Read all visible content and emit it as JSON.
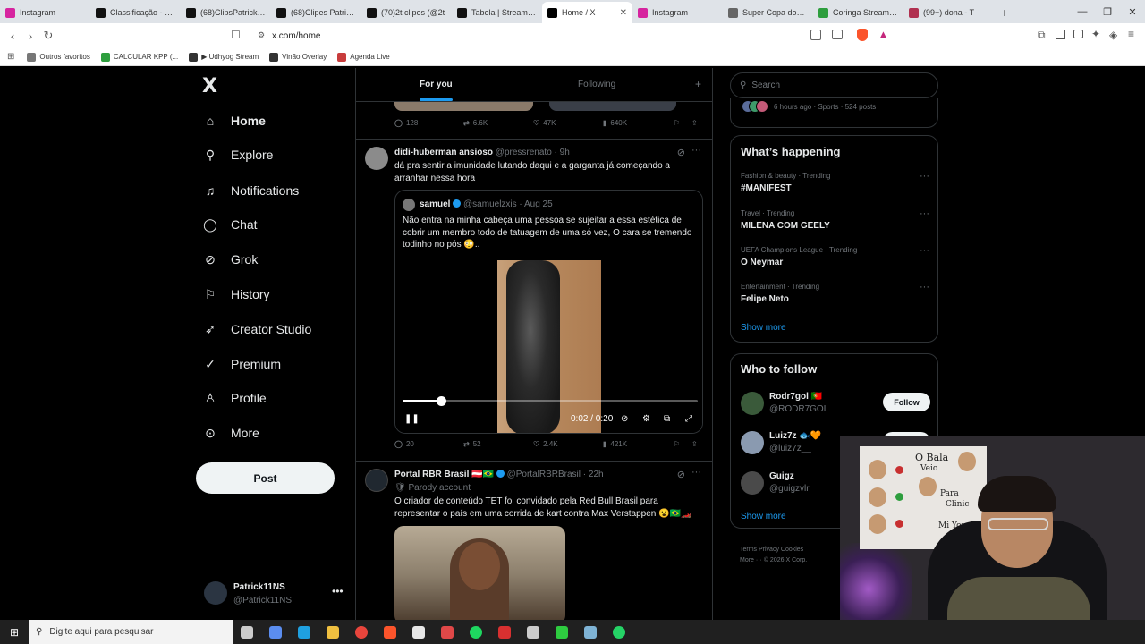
{
  "browser": {
    "tabs": [
      {
        "label": "Instagram",
        "color": "#d6249f",
        "active": false
      },
      {
        "label": "Classificação - Patri",
        "color": "#111111",
        "active": false
      },
      {
        "label": "(68)ClipsPatrickNs",
        "color": "#111111",
        "active": false
      },
      {
        "label": "(68)Clipes Patrick1",
        "color": "#111111",
        "active": false
      },
      {
        "label": "(70)2t clipes (@2t",
        "color": "#111111",
        "active": false
      },
      {
        "label": "Tabela | Streamme",
        "color": "#111111",
        "active": false
      },
      {
        "label": "Home / X",
        "color": "#000000",
        "active": true
      },
      {
        "label": "Instagram",
        "color": "#d6249f",
        "active": false
      },
      {
        "label": "Super Copa dos St",
        "color": "#666666",
        "active": false
      },
      {
        "label": "Coringa Stream - W",
        "color": "#2e9e3e",
        "active": false
      },
      {
        "label": "(99+) dona - T",
        "color": "#b03050",
        "active": false
      }
    ],
    "url": "x.com/home",
    "bookmarks": [
      {
        "label": "Outros favoritos",
        "color": "#777777"
      },
      {
        "label": "CALCULAR KPP (...",
        "color": "#2e9e3e"
      },
      {
        "label": "▶ Udhyog Stream",
        "color": "#333333"
      },
      {
        "label": "Vinão Overlay",
        "color": "#333333"
      },
      {
        "label": "Agenda Live",
        "color": "#c83c3c"
      }
    ]
  },
  "sidebar": {
    "logo": "X",
    "items": [
      {
        "label": "Home",
        "icon": "home-icon"
      },
      {
        "label": "Explore",
        "icon": "search-icon"
      },
      {
        "label": "Notifications",
        "icon": "bell-icon"
      },
      {
        "label": "Chat",
        "icon": "chat-icon"
      },
      {
        "label": "Grok",
        "icon": "grok-icon"
      },
      {
        "label": "History",
        "icon": "bookmark-icon"
      },
      {
        "label": "Creator Studio",
        "icon": "rocket-icon"
      },
      {
        "label": "Premium",
        "icon": "verified-icon"
      },
      {
        "label": "Profile",
        "icon": "person-icon"
      },
      {
        "label": "More",
        "icon": "more-circle-icon"
      }
    ],
    "post_label": "Post",
    "account": {
      "name": "Patrick11NS",
      "handle": "@Patrick11NS"
    }
  },
  "timeline": {
    "tabs": {
      "for_you": "For you",
      "following": "Following"
    },
    "prev_actions": {
      "replies": "128",
      "reposts": "6.6K",
      "likes": "47K",
      "views": "640K"
    },
    "tweet1": {
      "name": "didi-huberman ansioso",
      "handle": "@pressrenato",
      "time": "· 9h",
      "text": "dá pra sentir a imunidade lutando daqui e a garganta já começando a arranhar nessa hora",
      "quote": {
        "name": "samuel",
        "handle": "@samuelzxis",
        "time": "· Aug 25",
        "text": "Não entra na minha cabeça uma pessoa se sujeitar a essa estética de cobrir um membro todo de tatuagem de uma só vez, O cara se tremendo todinho no pós 😳..",
        "video_time": "0:02 / 0:20",
        "progress": 0.13
      },
      "actions": {
        "replies": "20",
        "reposts": "52",
        "likes": "2.4K",
        "views": "421K"
      }
    },
    "tweet2": {
      "name": "Portal RBR Brasil 🇦🇹🇧🇷",
      "handle": "@PortalRBRBrasil",
      "time": "· 22h",
      "parody": "Parody account",
      "text": "O criador de conteúdo TET foi convidado pela Red Bull Brasil para representar o país em uma corrida de kart contra Max Verstappen 😮🇧🇷🏎️"
    }
  },
  "right": {
    "search_placeholder": "Search",
    "topic_meta": "6 hours ago · Sports · 524 posts",
    "whats_happening": {
      "title": "What’s happening",
      "trends": [
        {
          "category": "Fashion & beauty · Trending",
          "name": "#MANIFEST"
        },
        {
          "category": "Travel · Trending",
          "name": "MILENA COM GEELY"
        },
        {
          "category": "UEFA Champions League · Trending",
          "name": "O Neymar"
        },
        {
          "category": "Entertainment · Trending",
          "name": "Felipe Neto"
        }
      ],
      "show_more": "Show more"
    },
    "who_to_follow": {
      "title": "Who to follow",
      "accounts": [
        {
          "name": "Rodr7gol 🇵🇹",
          "handle": "@RODR7GOL",
          "button": "Follow"
        },
        {
          "name": "Luiz7z 🐟🧡",
          "handle": "@luiz7z__",
          "button": "Follow"
        },
        {
          "name": "Guigz",
          "handle": "@guigzvlr",
          "button": ""
        }
      ],
      "show_more": "Show more"
    },
    "footer": {
      "line1": "Terms   Privacy   Cookies",
      "line2": "More ···  © 2026 X Corp."
    }
  },
  "webcam": {
    "board_texts": [
      "O Bala",
      "Veio",
      "Para",
      "Clinic",
      "Mi You"
    ]
  },
  "taskbar": {
    "search_placeholder": "Digite aqui para pesquisar",
    "apps": [
      {
        "name": "task-view-icon",
        "color": "#cccccc"
      },
      {
        "name": "copilot-icon",
        "color": "#5b8def"
      },
      {
        "name": "edge-icon",
        "color": "#1fa0e0"
      },
      {
        "name": "file-explorer-icon",
        "color": "#f0c040"
      },
      {
        "name": "chrome-icon",
        "color": "#e8453c"
      },
      {
        "name": "brave-icon",
        "color": "#fb542b"
      },
      {
        "name": "vscode-icon",
        "color": "#e7e7e7"
      },
      {
        "name": "file-icon",
        "color": "#e04848"
      },
      {
        "name": "spotify-icon",
        "color": "#1ed760"
      },
      {
        "name": "pack-icon",
        "color": "#d83030"
      },
      {
        "name": "obs-icon",
        "color": "#cccccc"
      },
      {
        "name": "stream-tool-icon",
        "color": "#2ecc40"
      },
      {
        "name": "notes-icon",
        "color": "#7fb3d5"
      },
      {
        "name": "whatsapp-icon",
        "color": "#25d366"
      }
    ]
  }
}
